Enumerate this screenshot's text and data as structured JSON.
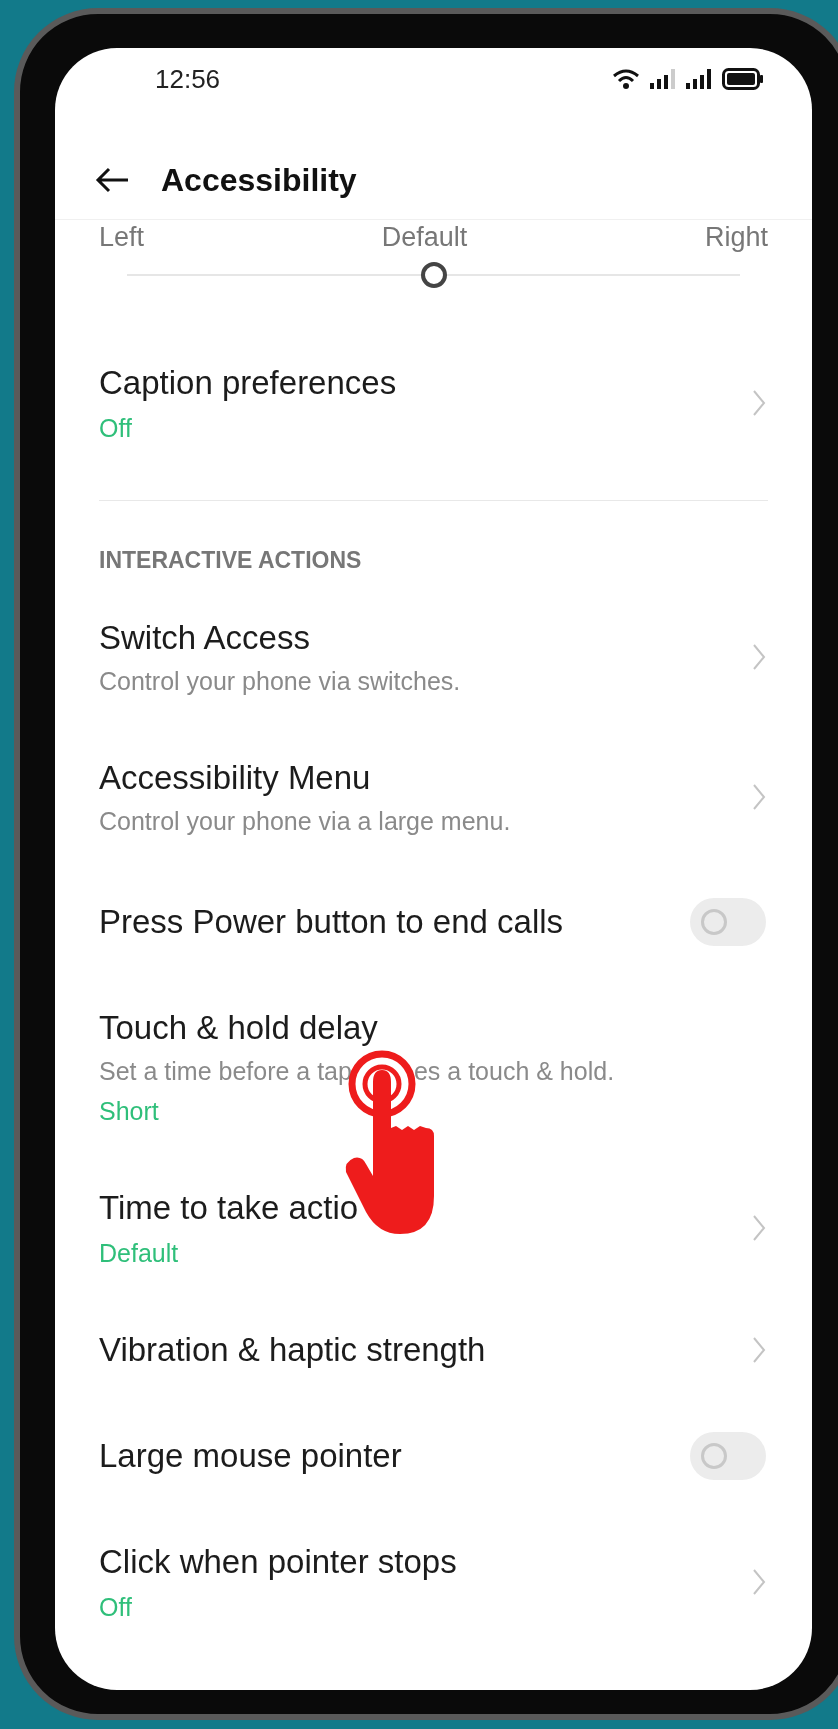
{
  "status_bar": {
    "time": "12:56"
  },
  "header": {
    "title": "Accessibility"
  },
  "slider": {
    "labels": [
      "Left",
      "Default",
      "Right"
    ],
    "level": 0.5
  },
  "items": [
    {
      "kind": "link",
      "title": "Caption preferences",
      "value": "Off"
    },
    {
      "kind": "section",
      "title": "INTERACTIVE ACTIONS"
    },
    {
      "kind": "link",
      "title": "Switch Access",
      "description": [
        "Control your phone via switches."
      ]
    },
    {
      "kind": "link",
      "title": "Accessibility Menu",
      "description": [
        "Control your phone via a large menu."
      ]
    },
    {
      "kind": "toggle",
      "title": "Press Power button to end calls",
      "on": false
    },
    {
      "kind": "text",
      "title": "Touch & hold delay",
      "description": [
        "Set a time before a tap",
        "es a touch & hold."
      ],
      "value": "Short"
    },
    {
      "kind": "link",
      "title": "Time to take actio",
      "value": "Default"
    },
    {
      "kind": "link",
      "title": "Vibration & haptic strength"
    },
    {
      "kind": "toggle",
      "title": "Large mouse pointer",
      "on": false
    },
    {
      "kind": "link",
      "title": "Click when pointer stops",
      "value": "Off"
    }
  ]
}
